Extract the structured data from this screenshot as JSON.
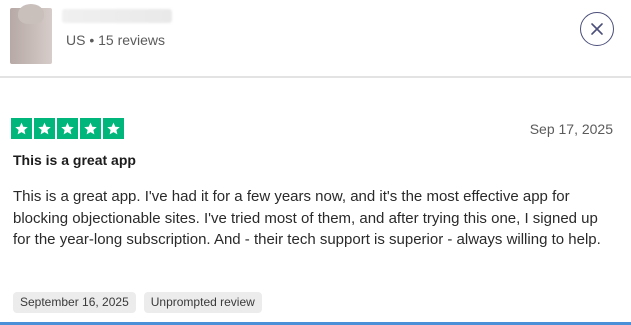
{
  "reviewer": {
    "meta": "US • 15 reviews"
  },
  "review": {
    "rating": 5,
    "rating_max": 5,
    "date": "Sep 17, 2025",
    "title": "This is a great app",
    "body": "This is a great app. I've had it for a few years now, and it's the most effective app for blocking objectionable sites. I've tried most of them, and after trying this one, I signed up for the year-long subscription. And - their tech support is superior - always willing to help.",
    "tags": [
      "September 16, 2025",
      "Unprompted review"
    ]
  },
  "icons": {
    "close": "close-icon",
    "star": "star-icon"
  },
  "colors": {
    "star_green": "#00b67a",
    "close_border": "#4b4f7a",
    "tag_bg": "#ececec"
  }
}
